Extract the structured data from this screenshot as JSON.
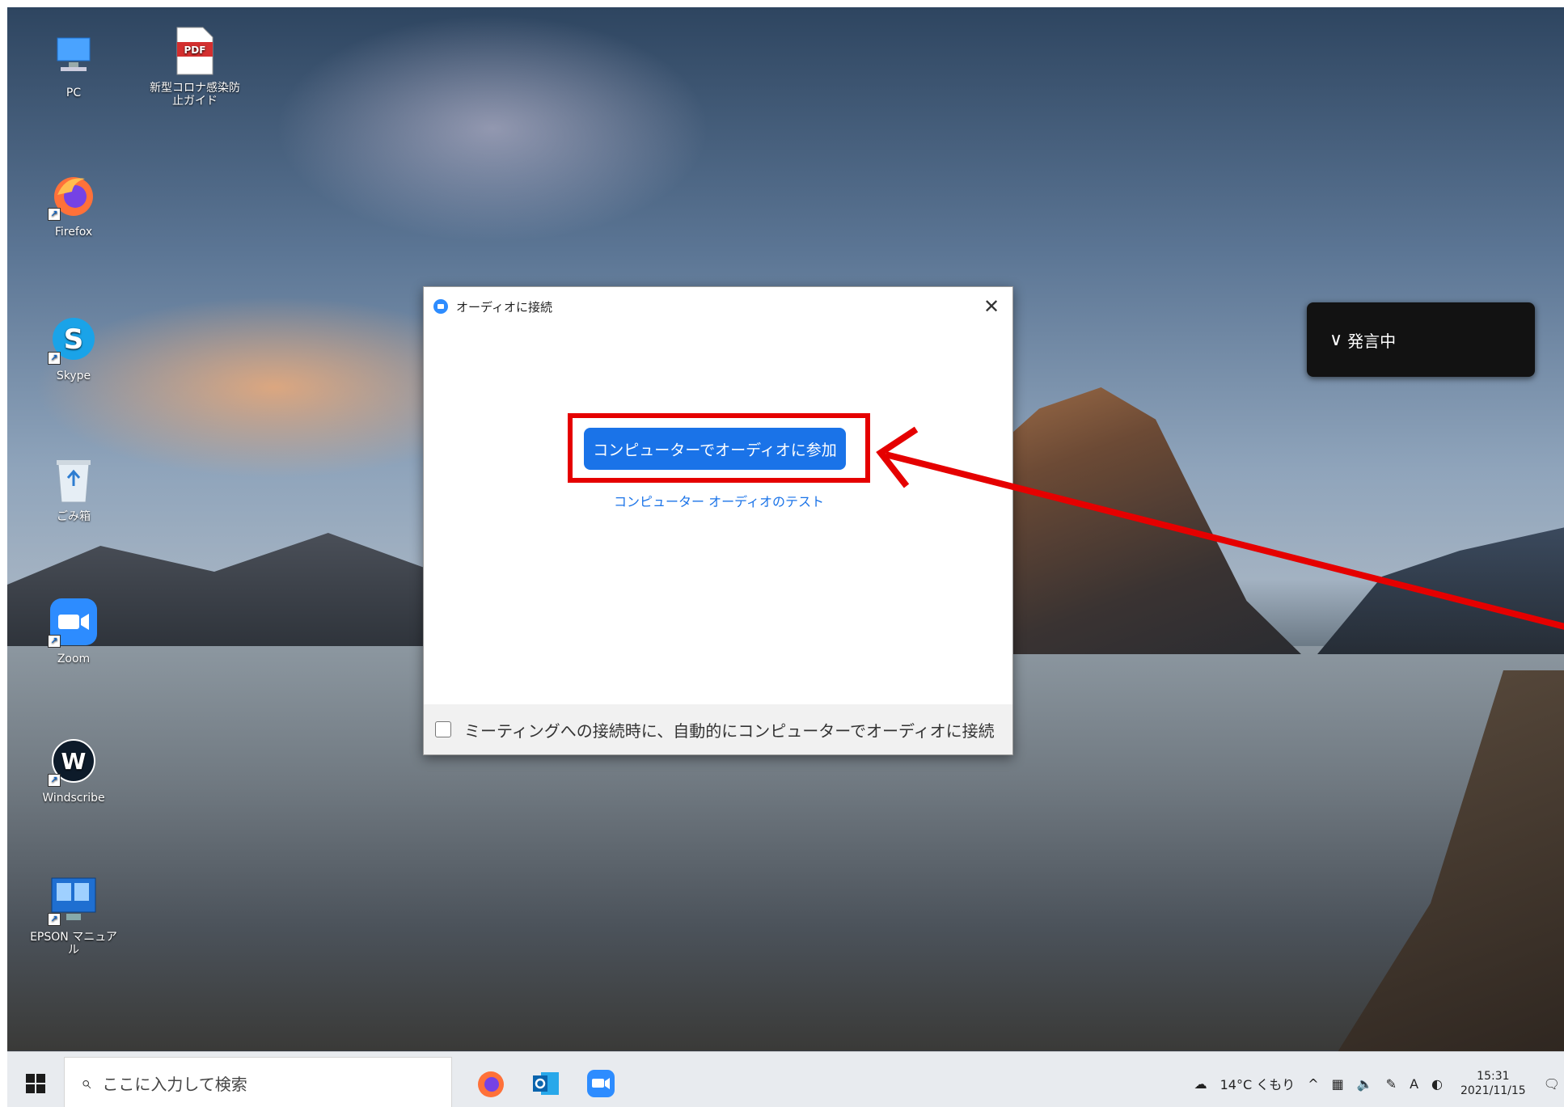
{
  "desktop": {
    "icons": [
      {
        "name": "pc",
        "label": "PC"
      },
      {
        "name": "pdf-file",
        "label": "新型コロナ感染防止ガイド"
      },
      {
        "name": "firefox",
        "label": "Firefox"
      },
      {
        "name": "skype",
        "label": "Skype"
      },
      {
        "name": "recycle-bin",
        "label": "ごみ箱"
      },
      {
        "name": "zoom",
        "label": "Zoom"
      },
      {
        "name": "windscribe",
        "label": "Windscribe"
      },
      {
        "name": "epson",
        "label": "EPSON マニュアル"
      }
    ]
  },
  "dialog": {
    "title": "オーディオに接続",
    "close_symbol": "✕",
    "join_button": "コンピューターでオーディオに参加",
    "test_link": "コンピューター オーディオのテスト",
    "auto_connect_label": "ミーティングへの接続時に、自動的にコンピューターでオーディオに接続"
  },
  "notice": {
    "chevron": "∨",
    "text": "発言中"
  },
  "taskbar": {
    "search_placeholder": "ここに入力して検索",
    "apps": [
      "firefox",
      "outlook",
      "zoom"
    ],
    "weather": "14°C くもり",
    "tray_chevron": "^",
    "ime": "A",
    "time": "15:31",
    "date": "2021/11/15"
  },
  "colors": {
    "accent": "#1a73e8",
    "highlight": "#e50000"
  }
}
